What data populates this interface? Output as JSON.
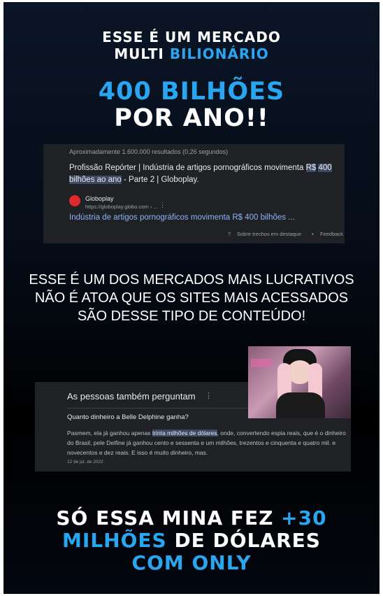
{
  "header": {
    "line1_part1": "ESSE É UM MERCADO",
    "line2_part1": "MULTI",
    "line2_part2": "BILIONÁRIO",
    "big1": "400 BILHÕES",
    "big2": "POR ANO!!"
  },
  "search_card": {
    "stats": "Aproximadamente 1.600.000 resultados (0,26 segundos)",
    "snippet_pre": "Profissão Repórter | Indústria de artigos pornográficos movimenta ",
    "snippet_mark1": "R$",
    "snippet_mark2": "400 bilhões ao ano",
    "snippet_post": " - Parte 2 | Globoplay.",
    "site_name": "Globoplay",
    "site_url": "https://globoplay.globo.com › ...",
    "result_title": "Indústria de artigos pornográficos movimenta R$ 400 bilhões ...",
    "featured_text": "Sobre trechos em destaque",
    "feedback_text": "Feedback"
  },
  "middle": {
    "line1": "ESSE É UM DOS MERCADOS MAIS LUCRATIVOS",
    "line2": "NÃO É ATOA QUE OS SITES MAIS ACESSADOS",
    "line3": "SÃO DESSE TIPO DE CONTEÚDO!"
  },
  "people_card": {
    "title": "As pessoas também perguntam",
    "question": "Quanto dinheiro a Belle Delphine ganha?",
    "answer_pre": "Pasmem, ela já ganhou apenas ",
    "answer_mark": "trinta milhões de dólares",
    "answer_post": ", onde, convertendo espia reais, que é o dinheiro do Brasil, pele Delfine já ganhou cento e sessenta e um milhões, trezentos e cinquenta e quatro mil. e novecentos e dez reais. E isso é muito dinheiro, mas.",
    "date": "12 de jul. de 2022"
  },
  "bottom": {
    "l1_a": "SÓ ESSA MINA FEZ",
    "l1_b": "+30",
    "l2_a": "MILHÕES",
    "l2_b": "DE DÓLARES",
    "l3": "COM ONLY"
  },
  "colors": {
    "accent_blue": "#2aa6f0",
    "card_bg": "#202124",
    "link_blue": "#8ab4f8",
    "highlight": "#3c4a63"
  }
}
